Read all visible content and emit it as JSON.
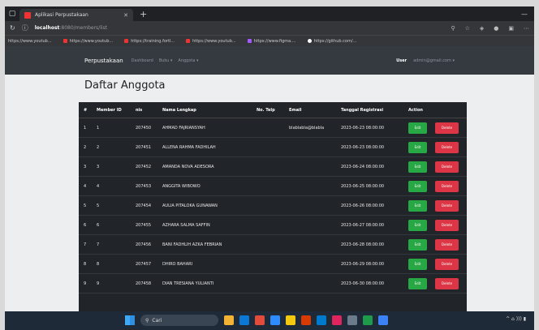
{
  "browser": {
    "tab_title": "Aplikasi Perpustakaan",
    "url_host": "localhost",
    "url_path": ":8080/members/list",
    "bookmarks": [
      "https://www.youtub...",
      "https://www.youtub...",
      "https://training.fortl...",
      "https://www.youtub...",
      "https://www.figma....",
      "https://github.com/..."
    ]
  },
  "navbar": {
    "brand": "Perpustakaan",
    "links": [
      "Dashboard",
      "Buku ▾",
      "Anggota ▾"
    ],
    "user_label": "User",
    "user_email": "admin@gmail.com ▾"
  },
  "page": {
    "title": "Daftar Anggota"
  },
  "table": {
    "headers": [
      "#",
      "Member ID",
      "nis",
      "Nama Lengkap",
      "No. Telp",
      "Email",
      "Tanggal Registrasi",
      "Action"
    ],
    "edit_label": "Edit",
    "delete_label": "Delete",
    "rows": [
      {
        "no": "1",
        "member_id": "1",
        "nis": "207450",
        "nama": "AHMAD FAJRIANSYAH",
        "telp": "",
        "email": "blablabla@blabla",
        "tanggal": "2023-06-23 08:00:00"
      },
      {
        "no": "2",
        "member_id": "2",
        "nis": "207451",
        "nama": "ALLENA RAHMA FADHILAH",
        "telp": "",
        "email": "",
        "tanggal": "2023-06-23 08:00:00"
      },
      {
        "no": "3",
        "member_id": "3",
        "nis": "207452",
        "nama": "AMANDA NOVA ADESORA",
        "telp": "",
        "email": "",
        "tanggal": "2023-06-24 08:00:00"
      },
      {
        "no": "4",
        "member_id": "4",
        "nis": "207453",
        "nama": "ANGGITA WIBOWO",
        "telp": "",
        "email": "",
        "tanggal": "2023-06-25 08:00:00"
      },
      {
        "no": "5",
        "member_id": "5",
        "nis": "207454",
        "nama": "AULIA PITALOKA GUNAWAN",
        "telp": "",
        "email": "",
        "tanggal": "2023-06-26 08:00:00"
      },
      {
        "no": "6",
        "member_id": "6",
        "nis": "207455",
        "nama": "AZHARA SALMA SAFFIN",
        "telp": "",
        "email": "",
        "tanggal": "2023-06-27 08:00:00"
      },
      {
        "no": "7",
        "member_id": "7",
        "nis": "207456",
        "nama": "BANI FADHLIH AZKA FEBRIAN",
        "telp": "",
        "email": "",
        "tanggal": "2023-06-28 08:00:00"
      },
      {
        "no": "8",
        "member_id": "8",
        "nis": "207457",
        "nama": "DHIRO BAHARI",
        "telp": "",
        "email": "",
        "tanggal": "2023-06-29 08:00:00"
      },
      {
        "no": "9",
        "member_id": "9",
        "nis": "207458",
        "nama": "DIAN TRESIANA YULIANTI",
        "telp": "",
        "email": "",
        "tanggal": "2023-06-30 08:00:00"
      }
    ]
  },
  "taskbar": {
    "search_placeholder": "Cari",
    "tray_text": "^ ⌂ ))) ▮"
  },
  "colors": {
    "navbar": "#343a40",
    "table": "#212529",
    "edit": "#28a745",
    "delete": "#dc3545"
  }
}
